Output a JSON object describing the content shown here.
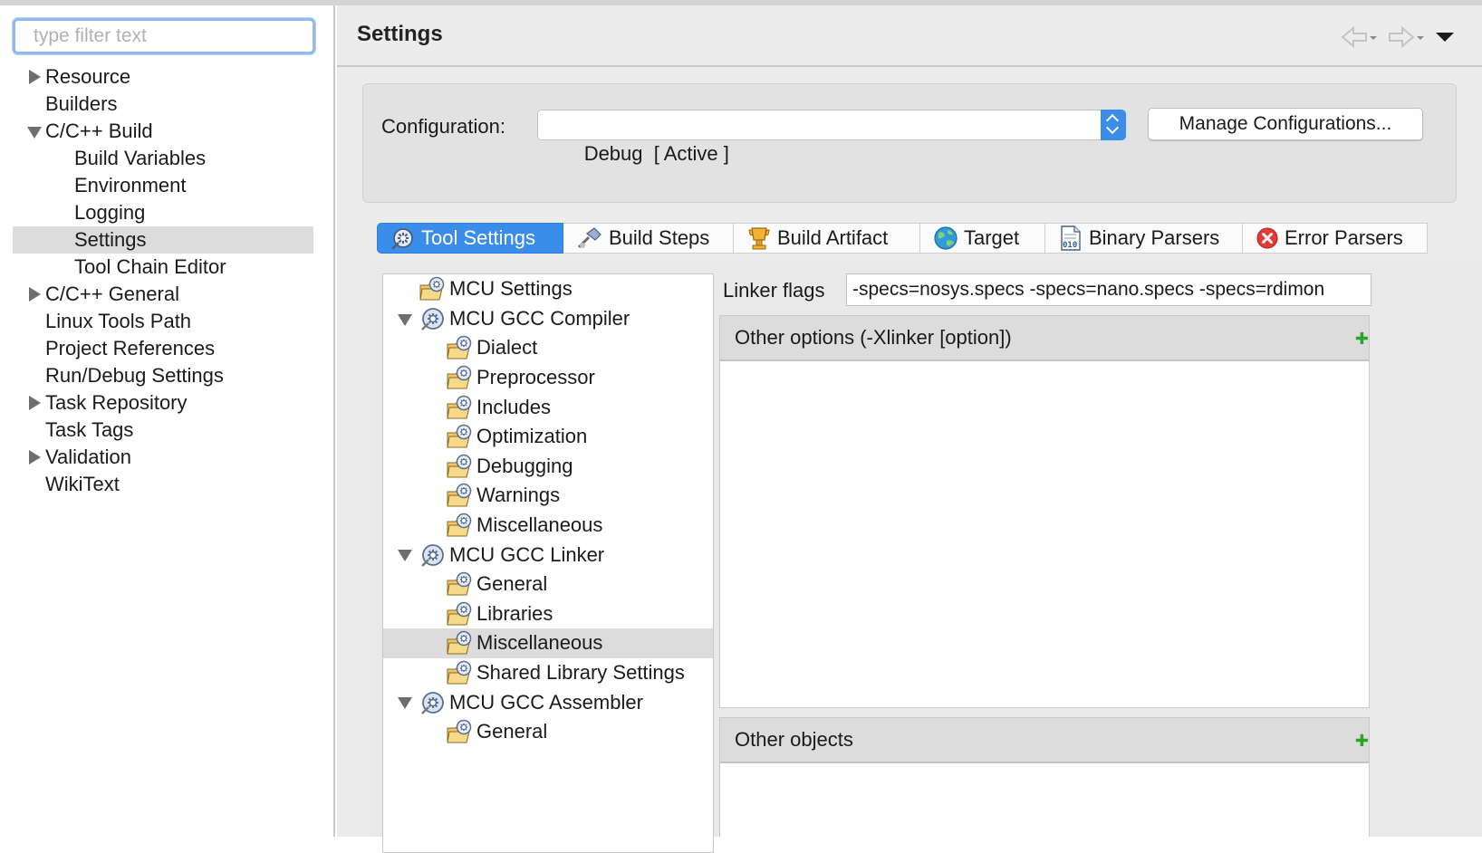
{
  "filter": {
    "placeholder": "type filter text"
  },
  "nav_tree": {
    "items": [
      {
        "label": "Resource",
        "expand": "collapsed",
        "level": 0
      },
      {
        "label": "Builders",
        "expand": "none",
        "level": 0
      },
      {
        "label": "C/C++ Build",
        "expand": "expanded",
        "level": 0
      },
      {
        "label": "Build Variables",
        "expand": "none",
        "level": 1
      },
      {
        "label": "Environment",
        "expand": "none",
        "level": 1
      },
      {
        "label": "Logging",
        "expand": "none",
        "level": 1
      },
      {
        "label": "Settings",
        "expand": "none",
        "level": 1,
        "selected": true
      },
      {
        "label": "Tool Chain Editor",
        "expand": "none",
        "level": 1
      },
      {
        "label": "C/C++ General",
        "expand": "collapsed",
        "level": 0
      },
      {
        "label": "Linux Tools Path",
        "expand": "none",
        "level": 0
      },
      {
        "label": "Project References",
        "expand": "none",
        "level": 0
      },
      {
        "label": "Run/Debug Settings",
        "expand": "none",
        "level": 0
      },
      {
        "label": "Task Repository",
        "expand": "collapsed",
        "level": 0
      },
      {
        "label": "Task Tags",
        "expand": "none",
        "level": 0
      },
      {
        "label": "Validation",
        "expand": "collapsed",
        "level": 0
      },
      {
        "label": "WikiText",
        "expand": "none",
        "level": 0
      }
    ]
  },
  "header": {
    "title": "Settings",
    "icons": [
      "back-arrow-icon",
      "forward-arrow-icon",
      "view-menu-icon"
    ]
  },
  "configuration": {
    "label": "Configuration:",
    "value": "Debug  [ Active ]",
    "manage_label": "Manage Configurations..."
  },
  "tabs": [
    {
      "label": "Tool Settings",
      "icon": "tool-settings-icon",
      "active": true
    },
    {
      "label": "Build Steps",
      "icon": "build-steps-icon",
      "active": false
    },
    {
      "label": "Build Artifact",
      "icon": "build-artifact-icon",
      "active": false
    },
    {
      "label": "Target",
      "icon": "target-icon",
      "active": false
    },
    {
      "label": "Binary Parsers",
      "icon": "binary-parsers-icon",
      "active": false
    },
    {
      "label": "Error Parsers",
      "icon": "error-parsers-icon",
      "active": false
    }
  ],
  "tool_tree": {
    "items": [
      {
        "label": "MCU Settings",
        "level": 0,
        "expand": "none",
        "icon": "folder-settings-icon"
      },
      {
        "label": "MCU GCC Compiler",
        "level": 0,
        "expand": "expanded",
        "icon": "tool-gear-icon"
      },
      {
        "label": "Dialect",
        "level": 1,
        "expand": "none",
        "icon": "folder-settings-icon"
      },
      {
        "label": "Preprocessor",
        "level": 1,
        "expand": "none",
        "icon": "folder-settings-icon"
      },
      {
        "label": "Includes",
        "level": 1,
        "expand": "none",
        "icon": "folder-settings-icon"
      },
      {
        "label": "Optimization",
        "level": 1,
        "expand": "none",
        "icon": "folder-settings-icon"
      },
      {
        "label": "Debugging",
        "level": 1,
        "expand": "none",
        "icon": "folder-settings-icon"
      },
      {
        "label": "Warnings",
        "level": 1,
        "expand": "none",
        "icon": "folder-settings-icon"
      },
      {
        "label": "Miscellaneous",
        "level": 1,
        "expand": "none",
        "icon": "folder-settings-icon"
      },
      {
        "label": "MCU GCC Linker",
        "level": 0,
        "expand": "expanded",
        "icon": "tool-gear-icon"
      },
      {
        "label": "General",
        "level": 1,
        "expand": "none",
        "icon": "folder-settings-icon"
      },
      {
        "label": "Libraries",
        "level": 1,
        "expand": "none",
        "icon": "folder-settings-icon"
      },
      {
        "label": "Miscellaneous",
        "level": 1,
        "expand": "none",
        "icon": "folder-settings-icon",
        "selected": true
      },
      {
        "label": "Shared Library Settings",
        "level": 1,
        "expand": "none",
        "icon": "folder-settings-icon"
      },
      {
        "label": "MCU GCC Assembler",
        "level": 0,
        "expand": "expanded",
        "icon": "tool-gear-icon"
      },
      {
        "label": "General",
        "level": 1,
        "expand": "none",
        "icon": "folder-settings-icon"
      }
    ]
  },
  "options": {
    "linker_flags_label": "Linker flags",
    "linker_flags_value": "-specs=nosys.specs -specs=nano.specs -specs=rdimon",
    "other_options_header": "Other options (-Xlinker [option])",
    "other_objects_header": "Other objects",
    "add_icon": "add-icon"
  },
  "colors": {
    "accent": "#3a8de8",
    "selection": "#dcdcdc",
    "panel": "#ececec",
    "add_green": "#2aa52a"
  }
}
